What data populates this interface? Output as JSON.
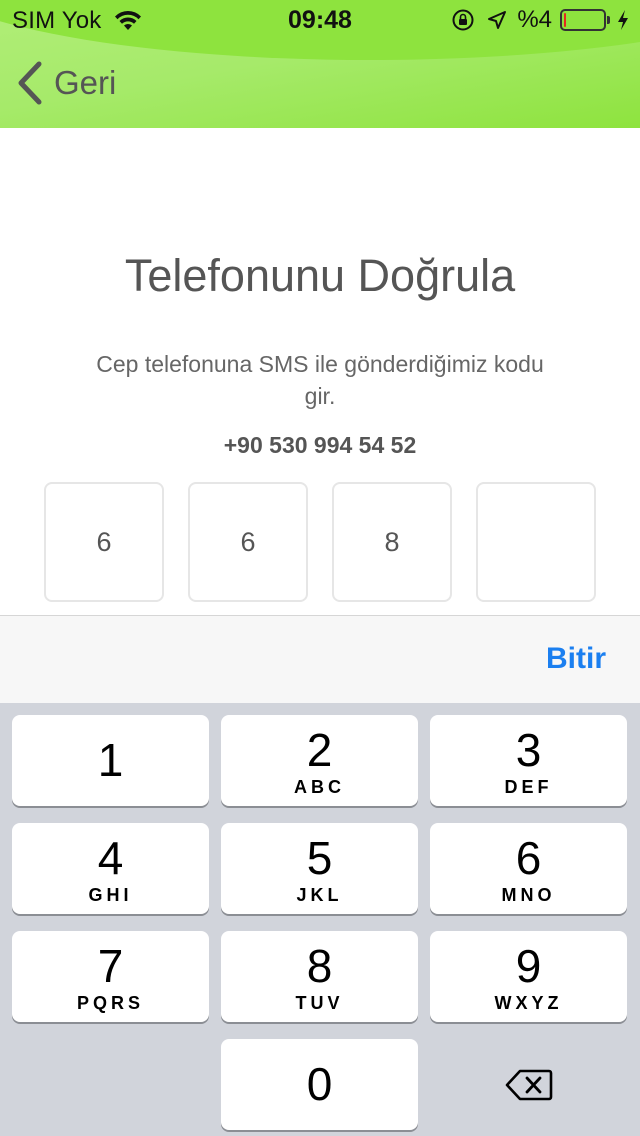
{
  "status_bar": {
    "carrier": "SIM Yok",
    "time": "09:48",
    "battery_percent": "%4",
    "battery_level_fraction": 0.04,
    "icons": [
      "wifi-icon",
      "orientation-lock-icon",
      "location-icon",
      "battery-icon",
      "charging-bolt-icon"
    ]
  },
  "nav": {
    "back_label": "Geri",
    "back_icon": "chevron-left-icon"
  },
  "main": {
    "title": "Telefonunu Doğrula",
    "subtitle": "Cep telefonuna SMS ile gönderdiğimiz kodu gir.",
    "phone_number": "+90 530 994 54 52",
    "code_digits": [
      "6",
      "6",
      "8",
      ""
    ]
  },
  "toolbar": {
    "done_label": "Bitir"
  },
  "keypad": {
    "keys": [
      {
        "digit": "1",
        "letters": ""
      },
      {
        "digit": "2",
        "letters": "ABC"
      },
      {
        "digit": "3",
        "letters": "DEF"
      },
      {
        "digit": "4",
        "letters": "GHI"
      },
      {
        "digit": "5",
        "letters": "JKL"
      },
      {
        "digit": "6",
        "letters": "MNO"
      },
      {
        "digit": "7",
        "letters": "PQRS"
      },
      {
        "digit": "8",
        "letters": "TUV"
      },
      {
        "digit": "9",
        "letters": "WXYZ"
      },
      {
        "digit": "0",
        "letters": ""
      }
    ],
    "delete_icon": "backspace-icon"
  },
  "colors": {
    "header_green": "#a6ea6a",
    "accent_blue": "#1b7ff0",
    "keypad_bg": "#d1d4db"
  }
}
